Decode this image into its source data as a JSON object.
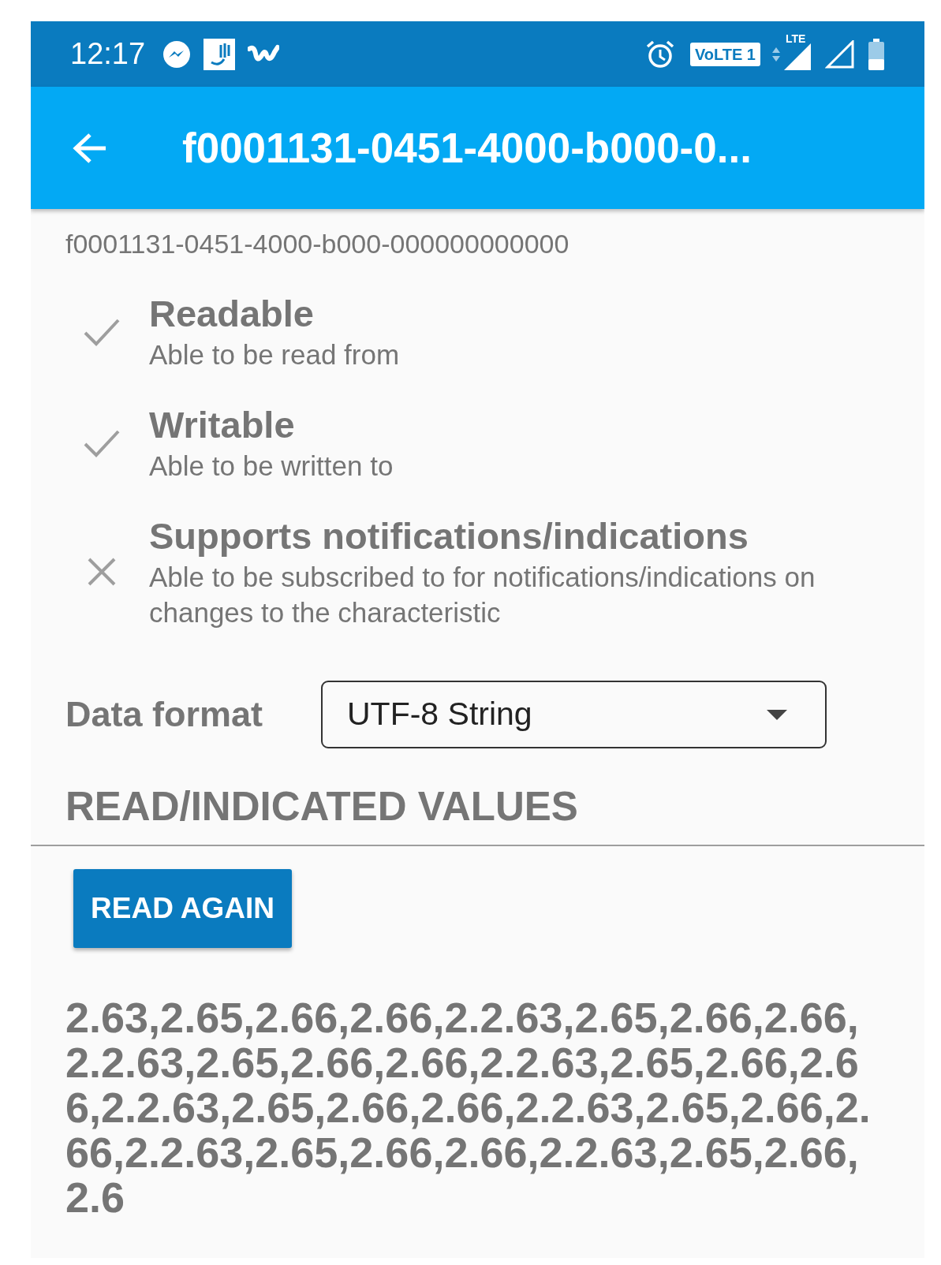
{
  "status_bar": {
    "time": "12:17",
    "volte": "VoLTE 1",
    "network": "LTE"
  },
  "app_bar": {
    "title": "f0001131-0451-4000-b000-0..."
  },
  "uuid": "f0001131-0451-4000-b000-000000000000",
  "properties": [
    {
      "title": "Readable",
      "description": "Able to be read from",
      "supported": true
    },
    {
      "title": "Writable",
      "description": "Able to be written to",
      "supported": true
    },
    {
      "title": "Supports notifications/indications",
      "description": "Able to be subscribed to for notifications/indications on changes to the characteristic",
      "supported": false
    }
  ],
  "data_format": {
    "label": "Data format",
    "value": "UTF-8 String"
  },
  "section_title": "READ/INDICATED VALUES",
  "read_button": "READ AGAIN",
  "values": "2.63,2.65,2.66,2.66,2.2.63,2.65,2.66,2.66,2.2.63,2.65,2.66,2.66,2.2.63,2.65,2.66,2.66,2.2.63,2.65,2.66,2.66,2.2.63,2.65,2.66,2.66,2.2.63,2.65,2.66,2.66,2.2.63,2.65,2.66,2.6"
}
